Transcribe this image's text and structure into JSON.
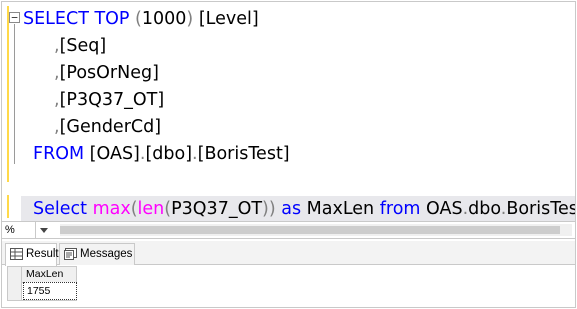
{
  "editor": {
    "lines": [
      {
        "parts": [
          [
            "kw",
            "SELECT "
          ],
          [
            "kw",
            "TOP "
          ],
          [
            "op",
            "("
          ],
          [
            "tx",
            "1000"
          ],
          [
            "op",
            ") "
          ],
          [
            "tx",
            "[Level]"
          ]
        ]
      },
      {
        "parts": [
          [
            "op",
            ","
          ],
          [
            "tx",
            "[Seq]"
          ]
        ]
      },
      {
        "parts": [
          [
            "op",
            ","
          ],
          [
            "tx",
            "[PosOrNeg]"
          ]
        ]
      },
      {
        "parts": [
          [
            "op",
            ","
          ],
          [
            "tx",
            "[P3Q37_OT]"
          ]
        ]
      },
      {
        "parts": [
          [
            "op",
            ","
          ],
          [
            "tx",
            "[GenderCd]"
          ]
        ]
      },
      {
        "parts": [
          [
            "kw",
            "FROM "
          ],
          [
            "tx",
            "[OAS]"
          ],
          [
            "op",
            "."
          ],
          [
            "tx",
            "[dbo]"
          ],
          [
            "op",
            "."
          ],
          [
            "tx",
            "[BorisTest]"
          ]
        ]
      },
      {
        "parts": []
      },
      {
        "parts": [
          [
            "kw",
            "Select "
          ],
          [
            "fn",
            "max"
          ],
          [
            "op",
            "("
          ],
          [
            "fn",
            "len"
          ],
          [
            "op",
            "("
          ],
          [
            "tx",
            "P3Q37_OT"
          ],
          [
            "op",
            "))"
          ],
          [
            "kw",
            " as "
          ],
          [
            "tx",
            "MaxLen "
          ],
          [
            "kw",
            "from "
          ],
          [
            "tx",
            "OAS"
          ],
          [
            "op",
            "."
          ],
          [
            "tx",
            "dbo"
          ],
          [
            "op",
            "."
          ],
          [
            "tx",
            "BorisTest"
          ]
        ]
      }
    ],
    "colors": {
      "keyword": "#0000ff",
      "function": "#ff00ff",
      "operator": "#808080",
      "text": "#000000"
    }
  },
  "zoom": {
    "value": "%",
    "dropdown_icon": "chevron-down-icon"
  },
  "tabs": [
    {
      "label": "Results",
      "icon": "grid-icon"
    },
    {
      "label": "Messages",
      "icon": "messages-icon"
    }
  ],
  "grid": {
    "columns": [
      "MaxLen"
    ],
    "rows": [
      [
        "1755"
      ]
    ]
  }
}
